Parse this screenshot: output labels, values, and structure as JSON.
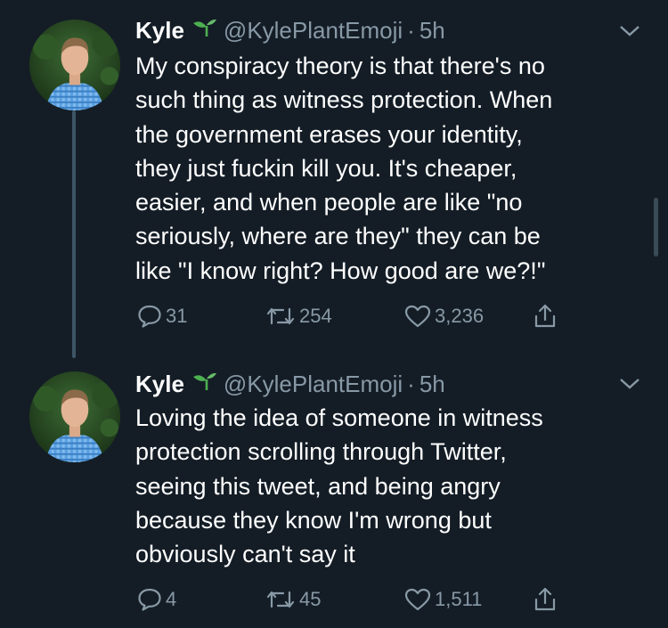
{
  "colors": {
    "background": "#141d26",
    "text": "#ffffff",
    "muted": "#8899a6",
    "sprout": "#4caf50",
    "thread_line": "#3d5466"
  },
  "tweets": [
    {
      "display_name": "Kyle",
      "name_emoji": "seedling-icon",
      "handle": "@KylePlantEmoji",
      "separator": "·",
      "time": "5h",
      "lines": [
        "My conspiracy theory is that there's no",
        "such thing as witness protection. When",
        "the government erases your identity,",
        "they just fuckin kill you. It's cheaper,",
        "easier, and when people are like \"no",
        "seriously, where are they\" they can be",
        "like \"I know right? How good are we?!\""
      ],
      "replies": "31",
      "retweets": "254",
      "likes": "3,236"
    },
    {
      "display_name": "Kyle",
      "name_emoji": "seedling-icon",
      "handle": "@KylePlantEmoji",
      "separator": "·",
      "time": "5h",
      "lines": [
        "Loving the idea of someone in witness",
        "protection scrolling through Twitter,",
        "seeing this tweet, and being angry",
        "because they know I'm wrong but",
        "obviously can't say it"
      ],
      "replies": "4",
      "retweets": "45",
      "likes": "1,511"
    }
  ]
}
